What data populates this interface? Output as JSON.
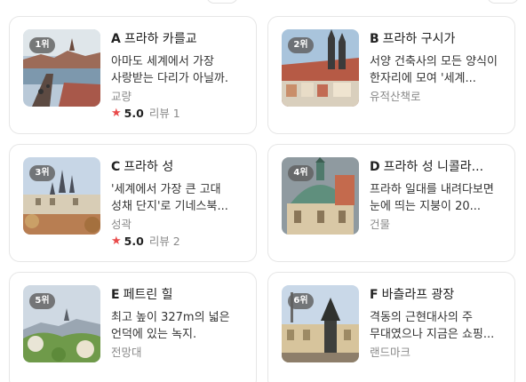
{
  "cards": [
    {
      "rank": "1위",
      "letter": "A",
      "name": "프라하 카를교",
      "desc": "아마도 세계에서 가장 사랑받는 다리가 아닐까.",
      "category": "교량",
      "score": "5.0",
      "reviews": "리뷰 1",
      "icon": "bridge-photo"
    },
    {
      "rank": "2위",
      "letter": "B",
      "name": "프라하 구시가",
      "desc": "서양 건축사의 모든 양식이 한자리에 모여 '세계...",
      "category": "유적산책로",
      "icon": "old-town-photo"
    },
    {
      "rank": "3위",
      "letter": "C",
      "name": "프라하 성",
      "desc": "'세계에서 가장 큰 고대 성채 단지'로 기네스북...",
      "category": "성곽",
      "score": "5.0",
      "reviews": "리뷰 2",
      "icon": "castle-photo"
    },
    {
      "rank": "4위",
      "letter": "D",
      "name": "프라하 성 니콜라...",
      "desc": "프라하 일대를 내려다보면 눈에 띄는 지붕이 20...",
      "category": "건물",
      "icon": "church-dome-photo"
    },
    {
      "rank": "5위",
      "letter": "E",
      "name": "페트린 힐",
      "desc": "최고 높이 327m의 넓은 언덕에 있는 녹지.",
      "category": "전망대",
      "icon": "hill-photo"
    },
    {
      "rank": "6위",
      "letter": "F",
      "name": "바츨라프 광장",
      "desc": "격동의 근현대사의 주 무대였으나 지금은 쇼핑...",
      "category": "랜드마크",
      "icon": "square-statue-photo"
    }
  ],
  "colors": {
    "star": "#e94a4a",
    "rank_badge": "#5f5f5f",
    "muted_text": "#8a8a8a"
  }
}
